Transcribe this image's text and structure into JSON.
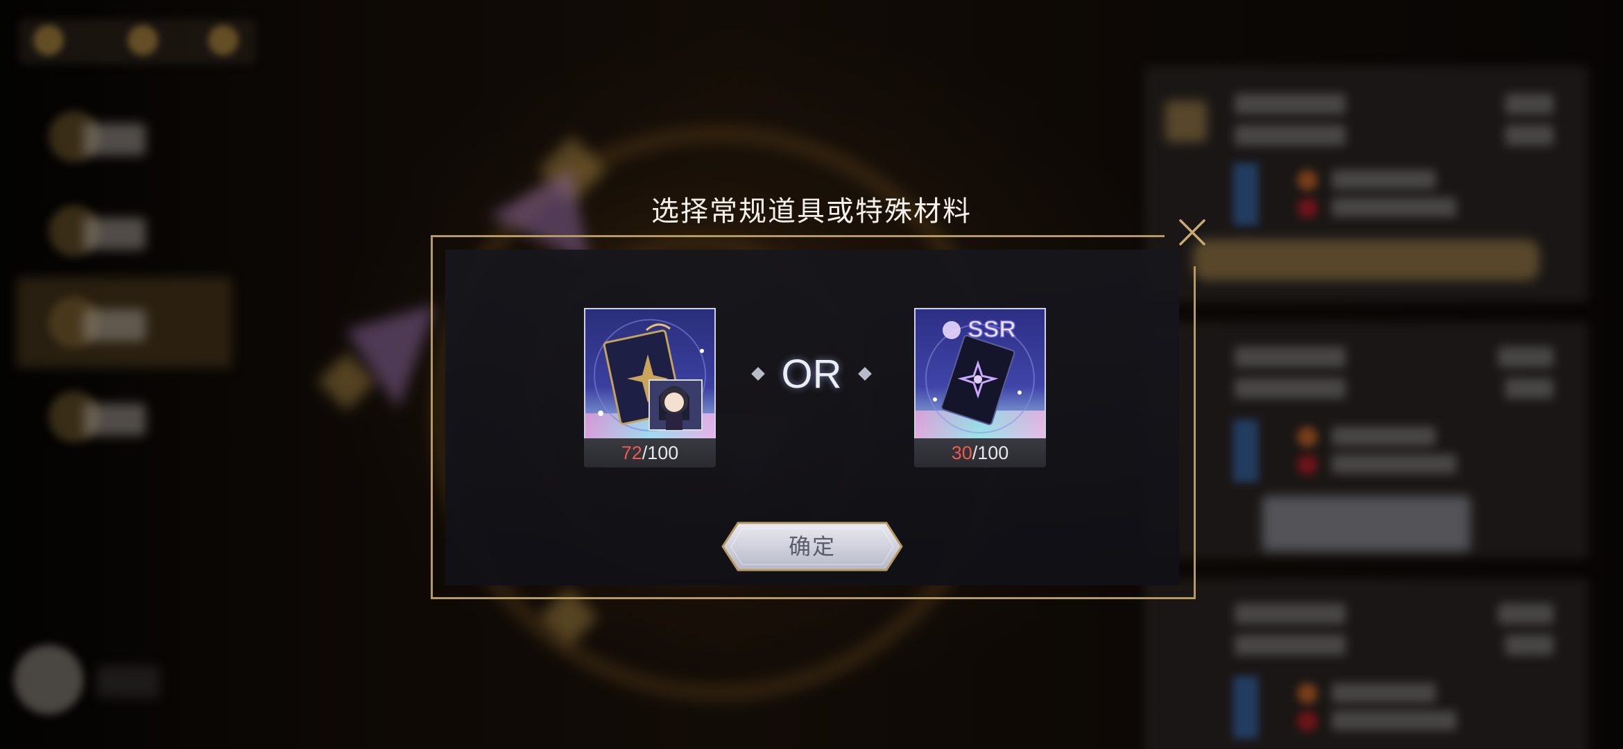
{
  "dialog": {
    "title": "选择常规道具或特殊材料",
    "separator": "OR",
    "confirm_label": "确定"
  },
  "items": [
    {
      "name": "regular-item",
      "current": "72",
      "total": "/100",
      "badge": ""
    },
    {
      "name": "special-material",
      "current": "30",
      "total": "/100",
      "badge": "SSR"
    }
  ],
  "colors": {
    "frame_gold": "#b79a62",
    "count_current": "#ef5a4e",
    "title_text": "#f5f1ea"
  }
}
